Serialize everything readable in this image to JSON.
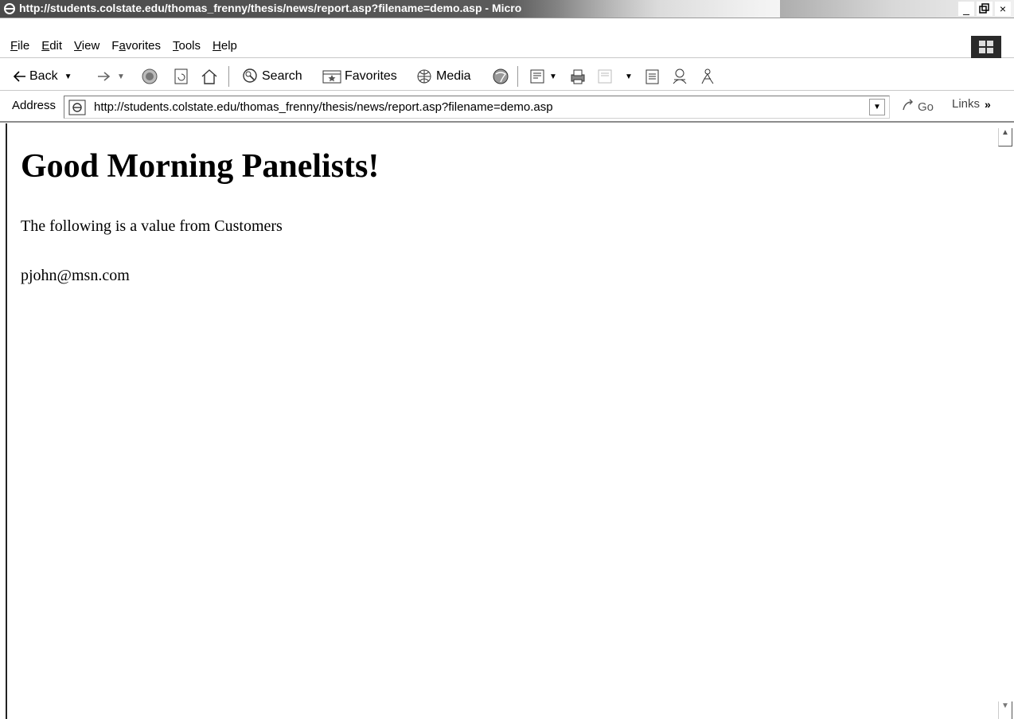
{
  "window": {
    "title": "http://students.colstate.edu/thomas_frenny/thesis/news/report.asp?filename=demo.asp - Micro",
    "minimize": "_",
    "restore": "̸",
    "close": "×"
  },
  "menu": {
    "items": [
      {
        "pre": "",
        "key": "F",
        "post": "ile"
      },
      {
        "pre": "",
        "key": "E",
        "post": "dit"
      },
      {
        "pre": "",
        "key": "V",
        "post": "iew"
      },
      {
        "pre": "F",
        "key": "a",
        "post": "vorites"
      },
      {
        "pre": "",
        "key": "T",
        "post": "ools"
      },
      {
        "pre": "",
        "key": "H",
        "post": "elp"
      }
    ]
  },
  "toolbar": {
    "back": "Back",
    "search": "Search",
    "favorites": "Favorites",
    "media": "Media"
  },
  "address": {
    "label": "Address",
    "url": "http://students.colstate.edu/thomas_frenny/thesis/news/report.asp?filename=demo.asp",
    "go": "Go",
    "links": "Links",
    "links_more": "»"
  },
  "page": {
    "heading": "Good Morning Panelists!",
    "text": "The following is a value from Customers",
    "email": "pjohn@msn.com"
  },
  "icons": [
    "ie-icon",
    "windows-logo-icon",
    "back-arrow-icon",
    "forward-arrow-icon",
    "stop-icon",
    "refresh-icon",
    "home-icon",
    "search-icon",
    "favorites-icon",
    "media-icon",
    "history-icon",
    "mail-icon",
    "print-icon",
    "edit-icon",
    "discuss-icon",
    "messenger-icon",
    "research-icon",
    "page-icon",
    "go-arrow-icon",
    "scroll-up-icon",
    "scroll-down-icon"
  ]
}
